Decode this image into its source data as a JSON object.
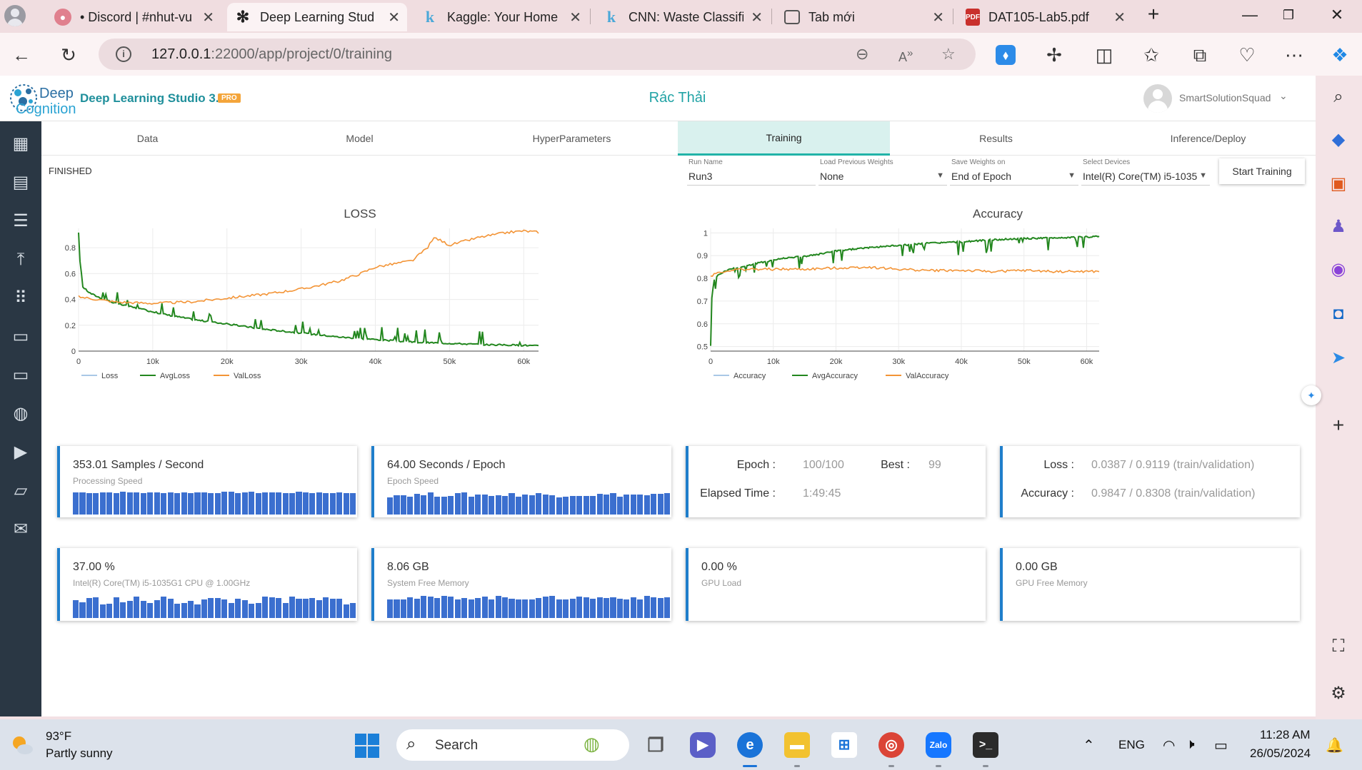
{
  "browser": {
    "tabs": [
      {
        "label": "• Discord | #nhut-vu",
        "icon": "discord-icon",
        "active": false
      },
      {
        "label": "Deep Learning Stud",
        "icon": "deep-cognition-icon",
        "active": true
      },
      {
        "label": "Kaggle: Your Home",
        "icon": "kaggle-icon",
        "active": false
      },
      {
        "label": "CNN: Waste Classifi",
        "icon": "kaggle-icon",
        "active": false
      },
      {
        "label": "Tab mới",
        "icon": "newtab-icon",
        "active": false
      },
      {
        "label": "DAT105-Lab5.pdf",
        "icon": "pdf-icon",
        "active": false
      }
    ],
    "url_host": "127.0.0.1",
    "url_path": ":22000/app/project/0/training"
  },
  "app": {
    "logo_deep": "Deep",
    "logo_cognition": "Cognition",
    "title": "Deep Learning Studio 3.0",
    "badge": "PRO",
    "project_name": "Rác Thải",
    "user_name": "SmartSolutionSquad",
    "colors": {
      "accent": "#21a3a5",
      "nav_bg": "#2a3744",
      "card_border": "#1f7ecb",
      "bar": "#3b6fcf"
    }
  },
  "nav": [
    "dashboard-icon",
    "projects-icon",
    "datasets-icon",
    "upload-icon",
    "apps-icon",
    "folder-icon",
    "monitor-icon",
    "chat-icon",
    "video-icon",
    "docs-icon",
    "mail-icon"
  ],
  "steps": [
    "Data",
    "Model",
    "HyperParameters",
    "Training",
    "Results",
    "Inference/Deploy"
  ],
  "active_step": "Training",
  "status": "FINISHED",
  "form": {
    "run_name_label": "Run Name",
    "run_name": "Run3",
    "load_weights_label": "Load Previous Weights",
    "load_weights": "None",
    "save_weights_label": "Save Weights on",
    "save_weights": "End of Epoch",
    "device_label": "Select Devices",
    "device": "Intel(R) Core(TM) i5-1035...",
    "start_button": "Start Training"
  },
  "chart_data": [
    {
      "type": "line",
      "title": "LOSS",
      "xlim": [
        0,
        62000
      ],
      "ylim": [
        0,
        0.95
      ],
      "x_ticks": [
        0,
        10000,
        20000,
        30000,
        40000,
        50000,
        60000
      ],
      "x_tick_labels": [
        "0",
        "10k",
        "20k",
        "30k",
        "40k",
        "50k",
        "60k"
      ],
      "y_ticks": [
        0,
        0.2,
        0.4,
        0.6,
        0.8
      ],
      "y_tick_labels": [
        "0",
        "0.2",
        "0.4",
        "0.6",
        "0.8"
      ],
      "grid": true,
      "legend": "bottom",
      "series": [
        {
          "name": "Loss",
          "color": "#a9c8e6",
          "x": [],
          "y": []
        },
        {
          "name": "AvgLoss",
          "color": "#23871f",
          "x": [
            0,
            500,
            1500,
            3000,
            5000,
            8000,
            12000,
            16000,
            20000,
            25000,
            30000,
            35000,
            40000,
            45000,
            50000,
            55000,
            60000,
            62000
          ],
          "y": [
            0.82,
            0.5,
            0.45,
            0.41,
            0.37,
            0.33,
            0.28,
            0.24,
            0.21,
            0.17,
            0.14,
            0.11,
            0.09,
            0.07,
            0.06,
            0.05,
            0.045,
            0.04
          ]
        },
        {
          "name": "ValLoss",
          "color": "#f39436",
          "x": [
            0,
            2500,
            5000,
            10000,
            15000,
            20000,
            25000,
            30000,
            35000,
            38000,
            40000,
            45000,
            47000,
            48000,
            50000,
            52000,
            54000,
            56000,
            58000,
            60000,
            62000
          ],
          "y": [
            0.42,
            0.4,
            0.38,
            0.37,
            0.38,
            0.41,
            0.44,
            0.48,
            0.54,
            0.6,
            0.65,
            0.7,
            0.8,
            0.88,
            0.82,
            0.85,
            0.88,
            0.9,
            0.92,
            0.93,
            0.92
          ]
        }
      ]
    },
    {
      "type": "line",
      "title": "Accuracy",
      "xlim": [
        0,
        62000
      ],
      "ylim": [
        0.48,
        1.02
      ],
      "x_ticks": [
        0,
        10000,
        20000,
        30000,
        40000,
        50000,
        60000
      ],
      "x_tick_labels": [
        "0",
        "10k",
        "20k",
        "30k",
        "40k",
        "50k",
        "60k"
      ],
      "y_ticks": [
        0.5,
        0.6,
        0.7,
        0.8,
        0.9,
        1
      ],
      "y_tick_labels": [
        "0.5",
        "0.6",
        "0.7",
        "0.8",
        "0.9",
        "1"
      ],
      "grid": true,
      "legend": "bottom",
      "series": [
        {
          "name": "Accuracy",
          "color": "#a9c8e6",
          "x": [],
          "y": []
        },
        {
          "name": "AvgAccuracy",
          "color": "#23871f",
          "x": [
            0,
            200,
            600,
            1500,
            3000,
            5000,
            8000,
            12000,
            16000,
            20000,
            25000,
            30000,
            35000,
            40000,
            45000,
            50000,
            55000,
            60000,
            62000
          ],
          "y": [
            0.5,
            0.72,
            0.8,
            0.82,
            0.84,
            0.85,
            0.87,
            0.89,
            0.9,
            0.92,
            0.935,
            0.945,
            0.955,
            0.96,
            0.97,
            0.975,
            0.978,
            0.982,
            0.985
          ]
        },
        {
          "name": "ValAccuracy",
          "color": "#f39436",
          "x": [
            0,
            1000,
            3000,
            5000,
            10000,
            15000,
            20000,
            25000,
            30000,
            35000,
            40000,
            45000,
            50000,
            55000,
            60000,
            62000
          ],
          "y": [
            0.81,
            0.825,
            0.835,
            0.84,
            0.84,
            0.84,
            0.845,
            0.85,
            0.84,
            0.835,
            0.835,
            0.83,
            0.835,
            0.83,
            0.83,
            0.83
          ]
        }
      ]
    }
  ],
  "cards": {
    "samples": {
      "title": "353.01 Samples / Second",
      "subtitle": "Processing Speed"
    },
    "epoch_speed": {
      "title": "64.00 Seconds / Epoch",
      "subtitle": "Epoch Speed"
    },
    "epoch": {
      "epoch_label": "Epoch :",
      "epoch_value": "100/100",
      "best_label": "Best :",
      "best_value": "99",
      "elapsed_label": "Elapsed Time :",
      "elapsed_value": "1:49:45"
    },
    "metrics": {
      "loss_label": "Loss :",
      "loss_value": "0.0387 / 0.9119 (train/validation)",
      "acc_label": "Accuracy :",
      "acc_value": "0.9847 / 0.8308 (train/validation)"
    },
    "cpu": {
      "title": "37.00 %",
      "subtitle": "Intel(R) Core(TM) i5-1035G1 CPU @ 1.00GHz"
    },
    "memory": {
      "title": "8.06 GB",
      "subtitle": "System Free Memory"
    },
    "gpu_load": {
      "title": "0.00 %",
      "subtitle": "GPU Load"
    },
    "gpu_mem": {
      "title": "0.00 GB",
      "subtitle": "GPU Free Memory"
    }
  },
  "taskbar": {
    "temperature": "93°F",
    "condition": "Partly sunny",
    "search_placeholder": "Search",
    "language": "ENG",
    "time": "11:28 AM",
    "date": "26/05/2024"
  }
}
